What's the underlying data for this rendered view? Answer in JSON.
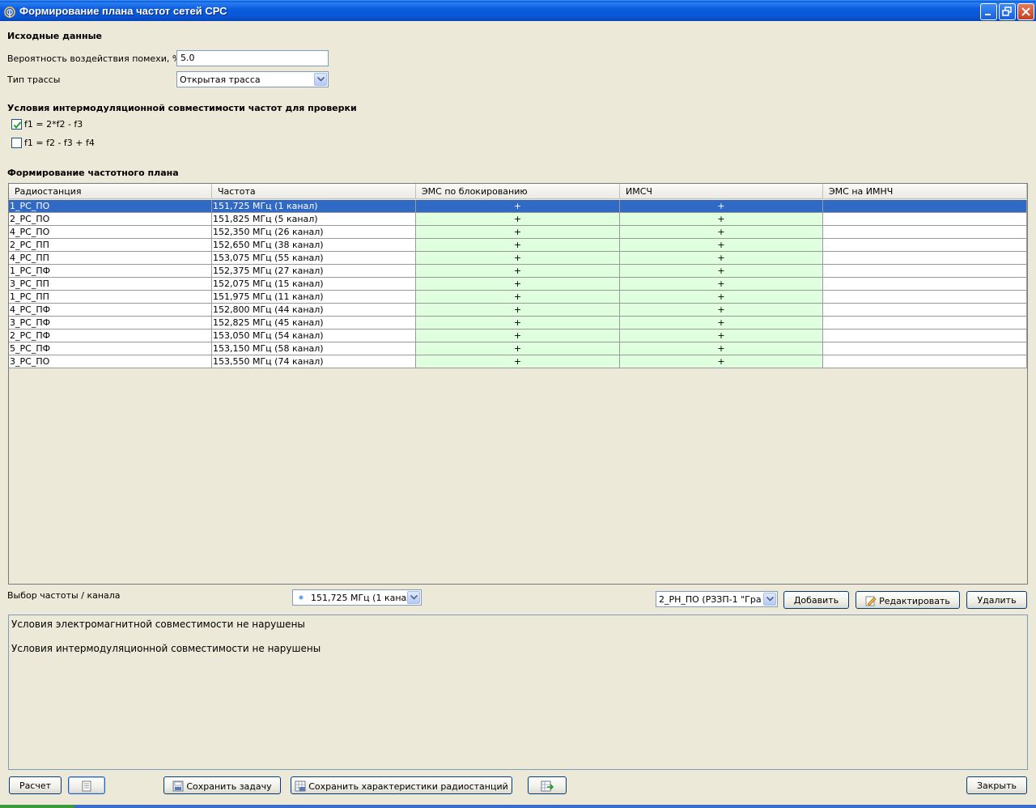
{
  "window": {
    "title": "Формирование плана частот сетей СРС"
  },
  "source": {
    "section_title": "Исходные данные",
    "prob_label": "Вероятность воздействия помехи, %",
    "prob_value": "5.0",
    "route_label": "Тип трассы",
    "route_value": "Открытая трасса"
  },
  "intermod": {
    "section_title": "Условия интермодуляционной совместимости частот для проверки",
    "options": [
      {
        "label": "f1 = 2*f2 - f3",
        "checked": true
      },
      {
        "label": "f1 = f2 - f3 + f4",
        "checked": false
      }
    ]
  },
  "plan": {
    "section_title": "Формирование частотного плана",
    "columns": [
      "Радиостанция",
      "Частота",
      "ЭМС по блокированию",
      "ИМСЧ",
      "ЭМС на ИМНЧ"
    ],
    "rows": [
      {
        "station": "1_РС_ПО",
        "freq": "151,725 МГц (1 канал)",
        "ems": "+",
        "imsch": "+",
        "imnch": ""
      },
      {
        "station": "2_РС_ПО",
        "freq": "151,825 МГц (5 канал)",
        "ems": "+",
        "imsch": "+",
        "imnch": ""
      },
      {
        "station": "4_РС_ПО",
        "freq": "152,350 МГц (26 канал)",
        "ems": "+",
        "imsch": "+",
        "imnch": ""
      },
      {
        "station": "2_РС_ПП",
        "freq": "152,650 МГц (38 канал)",
        "ems": "+",
        "imsch": "+",
        "imnch": ""
      },
      {
        "station": "4_РС_ПП",
        "freq": "153,075 МГц (55 канал)",
        "ems": "+",
        "imsch": "+",
        "imnch": ""
      },
      {
        "station": "1_РС_ПФ",
        "freq": "152,375 МГц (27 канал)",
        "ems": "+",
        "imsch": "+",
        "imnch": ""
      },
      {
        "station": "3_РС_ПП",
        "freq": "152,075 МГц (15 канал)",
        "ems": "+",
        "imsch": "+",
        "imnch": ""
      },
      {
        "station": "1_РС_ПП",
        "freq": "151,975 МГц (11 канал)",
        "ems": "+",
        "imsch": "+",
        "imnch": ""
      },
      {
        "station": "4_РС_ПФ",
        "freq": "152,800 МГц (44 канал)",
        "ems": "+",
        "imsch": "+",
        "imnch": ""
      },
      {
        "station": "3_РС_ПФ",
        "freq": "152,825 МГц (45 канал)",
        "ems": "+",
        "imsch": "+",
        "imnch": ""
      },
      {
        "station": "2_РС_ПФ",
        "freq": "153,050 МГц (54 канал)",
        "ems": "+",
        "imsch": "+",
        "imnch": ""
      },
      {
        "station": "5_РС_ПФ",
        "freq": "153,150 МГц (58 канал)",
        "ems": "+",
        "imsch": "+",
        "imnch": ""
      },
      {
        "station": "3_РС_ПО",
        "freq": "153,550 МГц (74 канал)",
        "ems": "+",
        "imsch": "+",
        "imnch": ""
      }
    ],
    "selected_row": 0
  },
  "controls": {
    "freq_select_label": "Выбор частоты / канала",
    "freq_select_value": "151,725 МГц (1 канал)",
    "station_select_value": "2_РН_ПО (РЗЗП-1 \"Гра...",
    "add_label": "Добавить",
    "edit_label": "Редактировать",
    "delete_label": "Удалить"
  },
  "messages": [
    "Условия электромагнитной совместимости не нарушены",
    "Условия интермодуляционной совместимости не нарушены"
  ],
  "footer": {
    "calc_label": "Расчет",
    "save_task_label": "Сохранить задачу",
    "save_chars_label": "Сохранить характеристики радиостанций",
    "close_label": "Закрыть"
  },
  "colors": {
    "selection": "#316ac5",
    "green_cell": "#dfffdf",
    "titlebar": "#0a54d2"
  }
}
